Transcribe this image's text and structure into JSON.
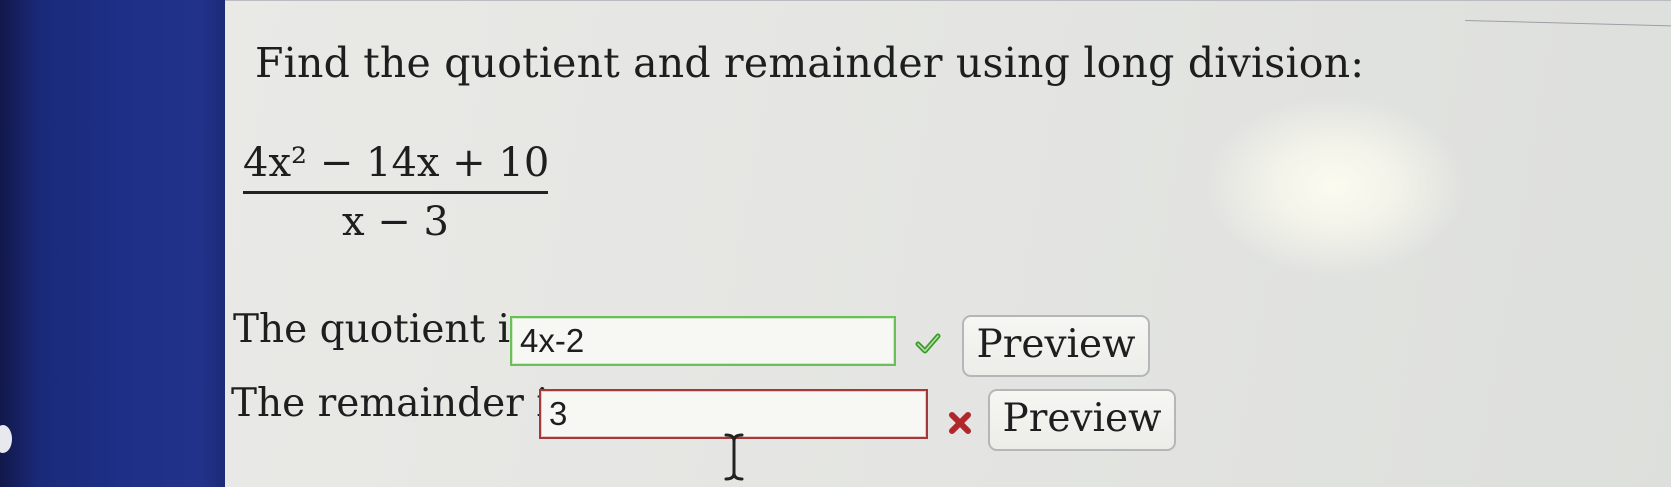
{
  "question": {
    "text": "Find the quotient and remainder using long division:"
  },
  "expression": {
    "numerator": "4x² − 14x + 10",
    "denominator": "x − 3"
  },
  "quotient_row": {
    "label": "The quotient is",
    "value": "4x-2",
    "status": "correct",
    "status_icon": "checkmark-icon",
    "status_color": "#3a9a2a",
    "preview_label": "Preview"
  },
  "remainder_row": {
    "label": "The remainder is",
    "value": "3",
    "status": "incorrect",
    "status_icon": "x-mark-icon",
    "status_color": "#b0262a",
    "preview_label": "Preview"
  }
}
